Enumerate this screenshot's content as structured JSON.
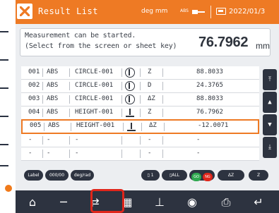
{
  "titlebar": {
    "title": "Result List",
    "units": "deg mm",
    "abs": "ABS",
    "date": "2022/01/3"
  },
  "message": {
    "line1": "Measurement can be started.",
    "line2": "(Select from the screen or sheet key)",
    "value": "76.7962",
    "unit": "mm"
  },
  "table": {
    "rows": [
      {
        "no": "001",
        "abs": "ABS",
        "feature": "CIRCLE-001",
        "icon": "circle-icon",
        "type": "Z",
        "value": "88.8033",
        "selected": false
      },
      {
        "no": "002",
        "abs": "ABS",
        "feature": "CIRCLE-001",
        "icon": "circle-icon",
        "type": "D",
        "value": "24.3765",
        "selected": false
      },
      {
        "no": "003",
        "abs": "ABS",
        "feature": "CIRCLE-001",
        "icon": "circle-icon",
        "type": "ΔZ",
        "value": "88.8033",
        "selected": false
      },
      {
        "no": "004",
        "abs": "ABS",
        "feature": "HEIGHT-001",
        "icon": "height-icon",
        "type": "Z",
        "value": "76.7962",
        "selected": false
      },
      {
        "no": "005",
        "abs": "ABS",
        "feature": "HEIGHT-001",
        "icon": "height-icon",
        "type": "ΔZ",
        "value": "-12.0071",
        "selected": true
      },
      {
        "no": "-",
        "abs": "-",
        "feature": "-",
        "icon": "",
        "type": "-",
        "value": "-",
        "selected": false
      },
      {
        "no": "-",
        "abs": "-",
        "feature": "-",
        "icon": "",
        "type": "-",
        "value": "-",
        "selected": false
      }
    ]
  },
  "side_buttons": [
    {
      "icon": "page-up-icon",
      "glyph": "⤒"
    },
    {
      "icon": "up-icon",
      "glyph": "▲"
    },
    {
      "icon": "down-icon",
      "glyph": "▼"
    },
    {
      "icon": "page-down-icon",
      "glyph": "⤓"
    }
  ],
  "chips": {
    "label": "Label",
    "count": "000/00",
    "angle_unit": "deg/rad",
    "one": "1",
    "all": "ALL",
    "go": "GO",
    "ng": "NG",
    "delta_z": "ΔZ",
    "z": "Z"
  },
  "toolbar": {
    "buttons": [
      {
        "icon": "home-icon",
        "glyph": "⌂"
      },
      {
        "icon": "minus-icon",
        "glyph": "─"
      },
      {
        "icon": "swap-icon",
        "glyph": "⇄"
      },
      {
        "icon": "grid-icon",
        "glyph": "▦"
      },
      {
        "icon": "tolerance-icon",
        "glyph": "⊥"
      },
      {
        "icon": "go-ng-icon",
        "glyph": "◉"
      },
      {
        "icon": "export-icon",
        "glyph": "⎙"
      },
      {
        "icon": "return-icon",
        "glyph": "↵"
      }
    ]
  },
  "colors": {
    "accent": "#ee7a24",
    "dark": "#2d3340",
    "go": "#2fa84f",
    "ng": "#e0261b",
    "highlight": "#e0261b"
  }
}
